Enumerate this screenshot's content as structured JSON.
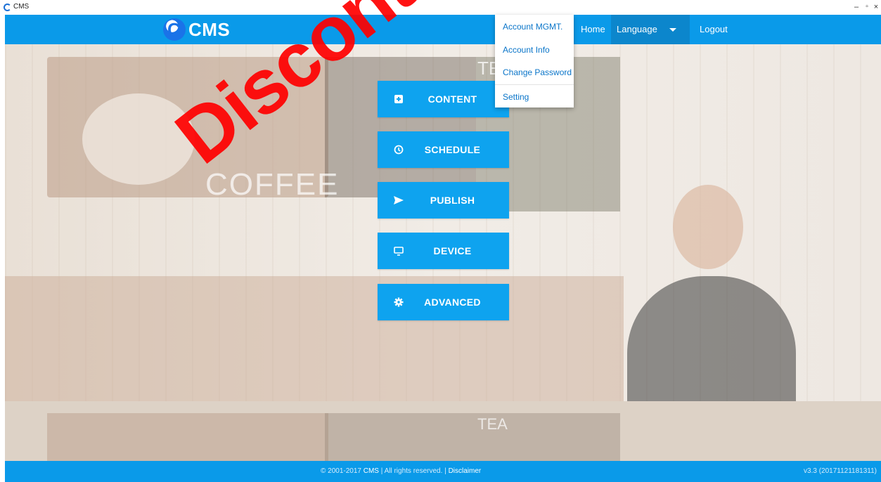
{
  "window": {
    "title": "CMS",
    "controls": {
      "minimize": "–",
      "maximize": "▫",
      "close": "×"
    }
  },
  "navbar": {
    "logo_text": "CMS",
    "home": "Home",
    "language": "Language",
    "logout": "Logout"
  },
  "dropdown": {
    "items": [
      "Account MGMT.",
      "Account Info",
      "Change Password",
      "Setting"
    ]
  },
  "background": {
    "coffee_word": "COFFEE",
    "tea_word": "TEA"
  },
  "tiles": [
    {
      "label": "CONTENT",
      "icon": "add-box-icon"
    },
    {
      "label": "SCHEDULE",
      "icon": "clock-icon"
    },
    {
      "label": "PUBLISH",
      "icon": "send-icon"
    },
    {
      "label": "DEVICE",
      "icon": "monitor-icon"
    },
    {
      "label": "ADVANCED",
      "icon": "gear-icon"
    }
  ],
  "watermark": "Discontinued",
  "footer": {
    "copyright_prefix": "© 2001-2017",
    "brand": "CMS",
    "rights": "| All rights reserved. |",
    "disclaimer": "Disclaimer",
    "version": "v3.3 (20171121181311)"
  },
  "colors": {
    "nav_bg": "#0a9ae9",
    "tile_bg": "#0ea3ef",
    "watermark": "#ff0000",
    "dropdown_text": "#0a75c9"
  }
}
